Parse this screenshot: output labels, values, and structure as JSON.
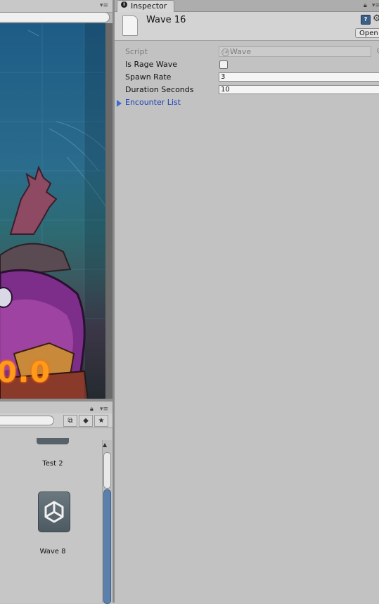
{
  "inspector": {
    "tab_label": "Inspector",
    "asset_title": "Wave 16",
    "open_button": "Open",
    "properties": {
      "script": {
        "label": "Script",
        "value": "Wave"
      },
      "is_rage_wave": {
        "label": "Is Rage Wave",
        "checked": false
      },
      "spawn_rate": {
        "label": "Spawn Rate",
        "value": "3"
      },
      "duration_seconds": {
        "label": "Duration Seconds",
        "value": "10"
      }
    },
    "encounter_list": {
      "label": "Encounter List",
      "expanded": false
    }
  },
  "scene_view": {
    "overlay_number": "0.0"
  },
  "project": {
    "assets": [
      {
        "label": "Test 2"
      },
      {
        "label": "Wave 8"
      }
    ]
  },
  "icons": {
    "inspector_tab": "info-icon",
    "lock": "lock-icon",
    "menu": "panel-menu-icon",
    "help": "help-book-icon",
    "settings": "gear-icon",
    "asset": "scriptable-object-file-icon",
    "unity_logo": "unity-logo-icon",
    "search_by_type": "filter-type-icon",
    "search_by_label": "label-tag-icon",
    "favorites": "star-icon"
  },
  "colors": {
    "link_blue": "#1a3fb9",
    "arrow_blue": "#3c6dcc",
    "scroll_blue": "#5b80ad",
    "panel_gray": "#c2c2c2",
    "overlay_orange": "#ff9a1a"
  }
}
